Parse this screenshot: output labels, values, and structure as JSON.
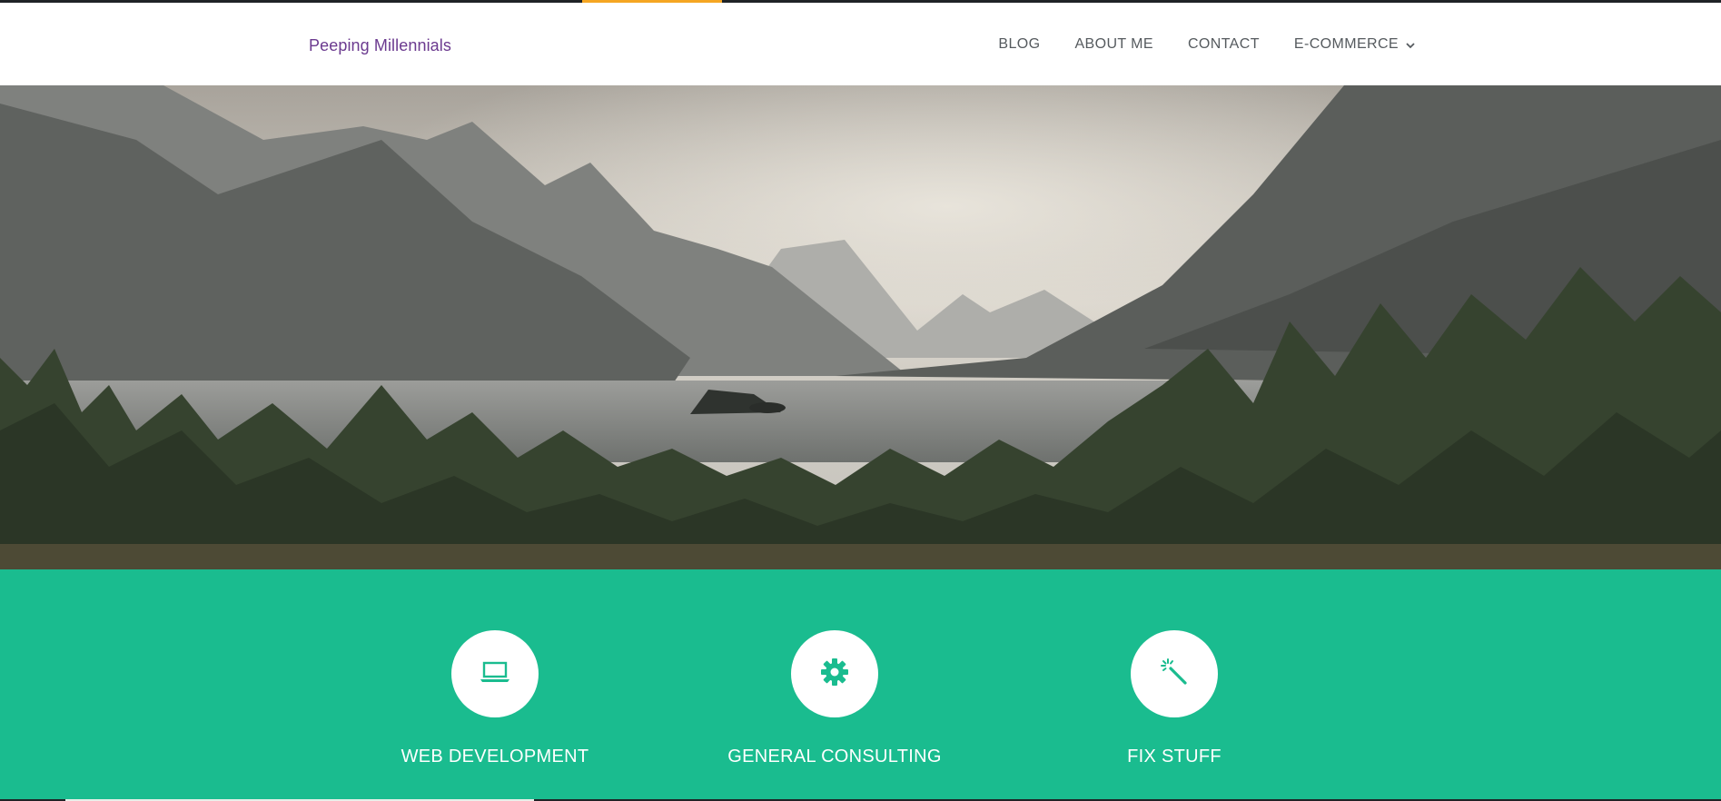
{
  "header": {
    "brand": "Peeping Millennials",
    "nav": [
      {
        "label": "BLOG"
      },
      {
        "label": "ABOUT ME"
      },
      {
        "label": "CONTACT"
      },
      {
        "label": "E-COMMERCE",
        "icon": "chevron-down-icon"
      }
    ]
  },
  "hero": {
    "image": "mountain-lake-landscape"
  },
  "services": [
    {
      "label": "WEB DEVELOPMENT",
      "icon": "laptop-icon"
    },
    {
      "label": "GENERAL CONSULTING",
      "icon": "gear-icon"
    },
    {
      "label": "FIX STUFF",
      "icon": "magic-wand-icon"
    }
  ],
  "colors": {
    "accent": "#f5a623",
    "brand": "#6b3a8f",
    "services_bg": "#1abc8f",
    "topbar": "#1f2326"
  }
}
